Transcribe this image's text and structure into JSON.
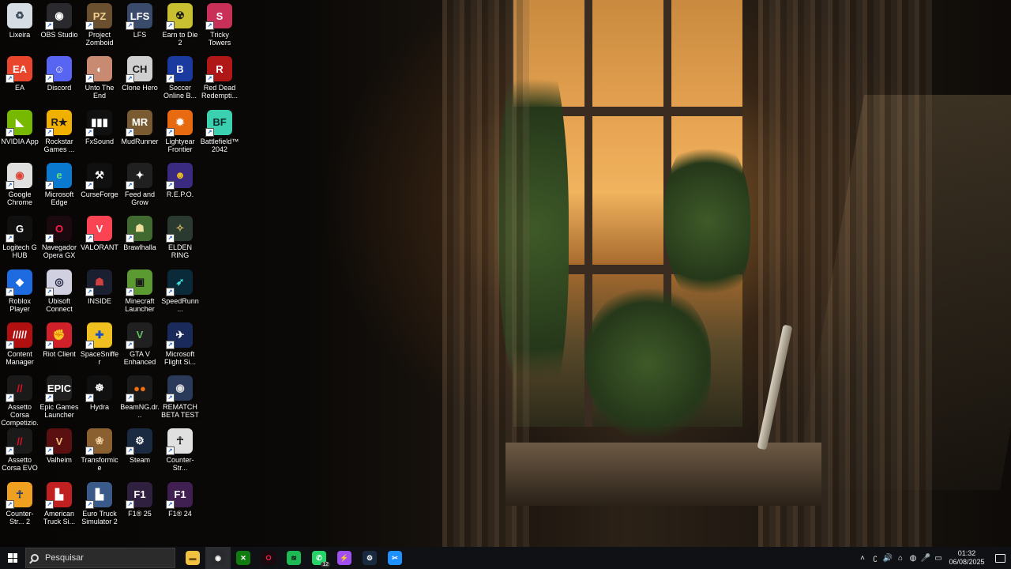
{
  "desktop": {
    "icons": [
      {
        "label": "Lixeira",
        "bg": "#d7dde4",
        "fg": "#3a4a5a",
        "sym": "♻",
        "shortcut": false
      },
      {
        "label": "OBS Studio",
        "bg": "#2a2a2e",
        "fg": "#ffffff",
        "sym": "◉",
        "shortcut": true
      },
      {
        "label": "Project Zomboid",
        "bg": "#6b5030",
        "fg": "#f0d090",
        "sym": "PZ",
        "shortcut": true
      },
      {
        "label": "LFS",
        "bg": "#3a4a6a",
        "fg": "#ffffff",
        "sym": "LFS",
        "shortcut": true
      },
      {
        "label": "Earn to Die 2",
        "bg": "#c8c030",
        "fg": "#1e1e1e",
        "sym": "☢",
        "shortcut": true
      },
      {
        "label": "Tricky Towers",
        "bg": "#c8305a",
        "fg": "#ffffff",
        "sym": "S",
        "shortcut": true
      },
      {
        "label": "EA",
        "bg": "#e8452c",
        "fg": "#ffffff",
        "sym": "EA",
        "shortcut": true
      },
      {
        "label": "Discord",
        "bg": "#5865f2",
        "fg": "#ffffff",
        "sym": "☺",
        "shortcut": true
      },
      {
        "label": "Unto The End",
        "bg": "#c88a70",
        "fg": "#ffffff",
        "sym": "◐",
        "shortcut": true
      },
      {
        "label": "Clone Hero",
        "bg": "#d0d0d0",
        "fg": "#1a1a1a",
        "sym": "CH",
        "shortcut": true
      },
      {
        "label": "Soccer Online B...",
        "bg": "#1a3aa0",
        "fg": "#ffffff",
        "sym": "B",
        "shortcut": true
      },
      {
        "label": "Red Dead Redempti...",
        "bg": "#b01818",
        "fg": "#ffffff",
        "sym": "R",
        "shortcut": true
      },
      {
        "label": "NVIDIA App",
        "bg": "#76b900",
        "fg": "#ffffff",
        "sym": "◣",
        "shortcut": true
      },
      {
        "label": "Rockstar Games ...",
        "bg": "#f0b000",
        "fg": "#1a1a1a",
        "sym": "R★",
        "shortcut": true
      },
      {
        "label": "FxSound",
        "bg": "#101010",
        "fg": "#ffffff",
        "sym": "▮▮▮",
        "shortcut": true
      },
      {
        "label": "MudRunner",
        "bg": "#7a5a30",
        "fg": "#ffffff",
        "sym": "MR",
        "shortcut": true
      },
      {
        "label": "Lightyear Frontier",
        "bg": "#e86a10",
        "fg": "#ffffff",
        "sym": "✹",
        "shortcut": true
      },
      {
        "label": "Battlefield™ 2042",
        "bg": "#3ad0b0",
        "fg": "#0a2a2a",
        "sym": "BF",
        "shortcut": true
      },
      {
        "label": "Google Chrome",
        "bg": "#e0e0e0",
        "fg": "#db4437",
        "sym": "◉",
        "shortcut": true
      },
      {
        "label": "Microsoft Edge",
        "bg": "#0a7ad0",
        "fg": "#6ee07a",
        "sym": "e",
        "shortcut": true
      },
      {
        "label": "CurseForge",
        "bg": "#101010",
        "fg": "#ffffff",
        "sym": "⚒",
        "shortcut": true
      },
      {
        "label": "Feed and Grow",
        "bg": "#202020",
        "fg": "#ffffff",
        "sym": "✦",
        "shortcut": true
      },
      {
        "label": "R.E.P.O.",
        "bg": "#3a2a80",
        "fg": "#f0c020",
        "sym": "☻",
        "shortcut": true
      },
      {
        "label": "Logitech G HUB",
        "bg": "#101010",
        "fg": "#ffffff",
        "sym": "G",
        "shortcut": true
      },
      {
        "label": "Navegador Opera GX",
        "bg": "#1a0a10",
        "fg": "#ff1b47",
        "sym": "O",
        "shortcut": true
      },
      {
        "label": "VALORANT",
        "bg": "#fa4454",
        "fg": "#ffffff",
        "sym": "V",
        "shortcut": true
      },
      {
        "label": "Brawlhalla",
        "bg": "#406a30",
        "fg": "#f0e0a0",
        "sym": "☗",
        "shortcut": true
      },
      {
        "label": "ELDEN RING",
        "bg": "#2a3a30",
        "fg": "#d0b060",
        "sym": "✧",
        "shortcut": true
      },
      {
        "label": "Roblox Player",
        "bg": "#1e6ae0",
        "fg": "#ffffff",
        "sym": "◆",
        "shortcut": true
      },
      {
        "label": "Ubisoft Connect",
        "bg": "#d0d0e0",
        "fg": "#202040",
        "sym": "◎",
        "shortcut": true
      },
      {
        "label": "INSIDE",
        "bg": "#1a2030",
        "fg": "#d04040",
        "sym": "☗",
        "shortcut": true
      },
      {
        "label": "Minecraft Launcher",
        "bg": "#5a9a30",
        "fg": "#1a1a1a",
        "sym": "▣",
        "shortcut": true
      },
      {
        "label": "SpeedRunn...",
        "bg": "#0a2a3a",
        "fg": "#40e0e0",
        "sym": "➶",
        "shortcut": true
      },
      {
        "label": "Content Manager",
        "bg": "#b01010",
        "fg": "#ffffff",
        "sym": "/////",
        "shortcut": true
      },
      {
        "label": "Riot Client",
        "bg": "#d0202a",
        "fg": "#ffffff",
        "sym": "✊",
        "shortcut": true
      },
      {
        "label": "SpaceSniffer",
        "bg": "#f0c020",
        "fg": "#1a50c0",
        "sym": "✚",
        "shortcut": true
      },
      {
        "label": "GTA V Enhanced",
        "bg": "#202020",
        "fg": "#60c060",
        "sym": "V",
        "shortcut": true
      },
      {
        "label": "Microsoft Flight Si...",
        "bg": "#1a2a5a",
        "fg": "#ffffff",
        "sym": "✈",
        "shortcut": true
      },
      {
        "label": "Assetto Corsa Competizio...",
        "bg": "#1a1a1a",
        "fg": "#e01020",
        "sym": "//",
        "shortcut": true
      },
      {
        "label": "Epic Games Launcher",
        "bg": "#202020",
        "fg": "#ffffff",
        "sym": "EPIC",
        "shortcut": true
      },
      {
        "label": "Hydra",
        "bg": "#101010",
        "fg": "#ffffff",
        "sym": "☸",
        "shortcut": true
      },
      {
        "label": "BeamNG.dr...",
        "bg": "#1a1a1a",
        "fg": "#f07010",
        "sym": "●●",
        "shortcut": true
      },
      {
        "label": "REMATCH BETA TEST",
        "bg": "#2a3a5a",
        "fg": "#e0e0e0",
        "sym": "◉",
        "shortcut": true
      },
      {
        "label": "Assetto Corsa EVO",
        "bg": "#1a1a1a",
        "fg": "#e01020",
        "sym": "//",
        "shortcut": true
      },
      {
        "label": "Valheim",
        "bg": "#5a1010",
        "fg": "#f0c080",
        "sym": "V",
        "shortcut": true
      },
      {
        "label": "Transformice",
        "bg": "#8a6030",
        "fg": "#f0d0a0",
        "sym": "❀",
        "shortcut": true
      },
      {
        "label": "Steam",
        "bg": "#1a2a40",
        "fg": "#ffffff",
        "sym": "⚙",
        "shortcut": true
      },
      {
        "label": "Counter-Str...",
        "bg": "#e0e0e0",
        "fg": "#1a1a1a",
        "sym": "☥",
        "shortcut": true
      },
      {
        "label": "Counter-Str... 2",
        "bg": "#f0a020",
        "fg": "#1a3a70",
        "sym": "☥",
        "shortcut": true
      },
      {
        "label": "American Truck Si...",
        "bg": "#c02020",
        "fg": "#ffffff",
        "sym": "▙",
        "shortcut": true
      },
      {
        "label": "Euro Truck Simulator 2",
        "bg": "#3a5a8a",
        "fg": "#ffffff",
        "sym": "▙",
        "shortcut": true
      },
      {
        "label": "F1® 25",
        "bg": "#302040",
        "fg": "#ffffff",
        "sym": "F1",
        "shortcut": true
      },
      {
        "label": "F1® 24",
        "bg": "#402050",
        "fg": "#ffffff",
        "sym": "F1",
        "shortcut": true
      }
    ]
  },
  "taskbar": {
    "search_placeholder": "Pesquisar",
    "apps": [
      {
        "name": "file-explorer",
        "bg": "#f0c040",
        "fg": "#6a4a10",
        "sym": "▬",
        "active": false,
        "badge": ""
      },
      {
        "name": "obs-studio",
        "bg": "#2a2a2e",
        "fg": "#ffffff",
        "sym": "◉",
        "active": true,
        "badge": ""
      },
      {
        "name": "xbox",
        "bg": "#107c10",
        "fg": "#ffffff",
        "sym": "✕",
        "active": false,
        "badge": ""
      },
      {
        "name": "opera-gx",
        "bg": "#1a0a10",
        "fg": "#ff1b47",
        "sym": "O",
        "active": false,
        "badge": ""
      },
      {
        "name": "spotify",
        "bg": "#1db954",
        "fg": "#101010",
        "sym": "≋",
        "active": false,
        "badge": ""
      },
      {
        "name": "whatsapp",
        "bg": "#25d366",
        "fg": "#ffffff",
        "sym": "✆",
        "active": false,
        "badge": "12"
      },
      {
        "name": "messenger",
        "bg": "#a050f0",
        "fg": "#ffffff",
        "sym": "⚡",
        "active": false,
        "badge": ""
      },
      {
        "name": "steam",
        "bg": "#1a2a40",
        "fg": "#ffffff",
        "sym": "⚙",
        "active": false,
        "badge": ""
      },
      {
        "name": "snipping-tool",
        "bg": "#1e90ff",
        "fg": "#ffffff",
        "sym": "✂",
        "active": false,
        "badge": ""
      }
    ],
    "tray": {
      "icons": [
        "chevron-up-icon",
        "bluetooth-icon",
        "volume-icon",
        "network-icon",
        "vpn-icon",
        "microphone-icon",
        "display-icon"
      ],
      "icon_syms": [
        "˄",
        "ʗ",
        "🔊",
        "⌂",
        "◍",
        "🎤",
        "▭"
      ],
      "time": "01:32",
      "date": "06/08/2025"
    }
  }
}
